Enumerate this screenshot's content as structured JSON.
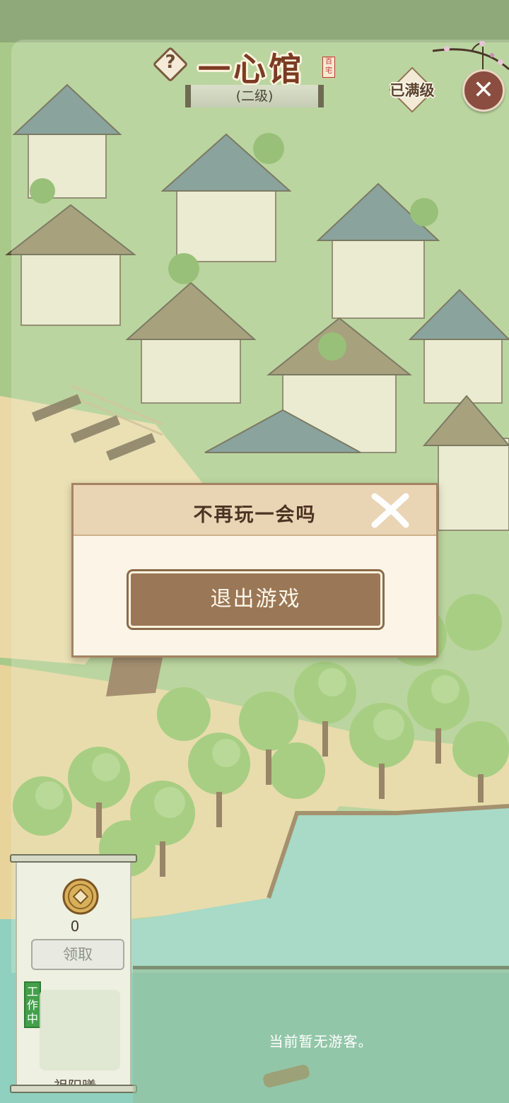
{
  "header": {
    "help_icon": "question-icon",
    "help_symbol": "?",
    "building_name": "一心馆",
    "seal_text": "百宅",
    "level_text": "(二级)",
    "max_level_text": "已满级",
    "close_icon": "close-icon",
    "close_symbol": "✕"
  },
  "dialog": {
    "title": "不再玩一会吗",
    "close_icon": "brush-x-icon",
    "exit_button_label": "退出游戏"
  },
  "worker": {
    "coin_icon": "copper-coin-icon",
    "coin_count": "0",
    "claim_button_label": "领取",
    "status_tag": "工作中",
    "name": "祖阳曦"
  },
  "visitors": {
    "empty_text": "当前暂无游客。"
  },
  "colors": {
    "title": "#7b3b22",
    "exit_button": "#9a7756",
    "working_tag": "#43a04a",
    "water": "#8fd0bf",
    "grass": "#8fc063"
  }
}
